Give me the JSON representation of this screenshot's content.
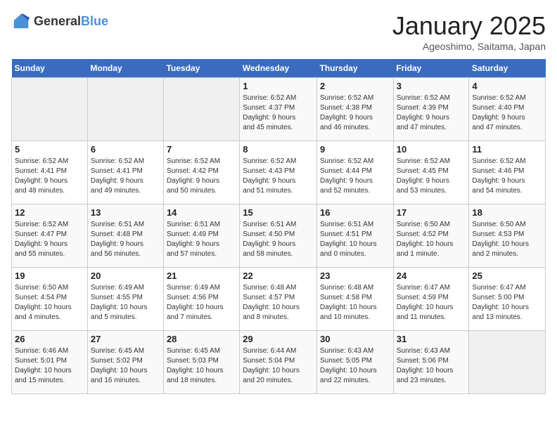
{
  "header": {
    "logo_general": "General",
    "logo_blue": "Blue",
    "title": "January 2025",
    "subtitle": "Ageoshimo, Saitama, Japan"
  },
  "weekdays": [
    "Sunday",
    "Monday",
    "Tuesday",
    "Wednesday",
    "Thursday",
    "Friday",
    "Saturday"
  ],
  "weeks": [
    [
      {
        "day": "",
        "info": ""
      },
      {
        "day": "",
        "info": ""
      },
      {
        "day": "",
        "info": ""
      },
      {
        "day": "1",
        "info": "Sunrise: 6:52 AM\nSunset: 4:37 PM\nDaylight: 9 hours\nand 45 minutes."
      },
      {
        "day": "2",
        "info": "Sunrise: 6:52 AM\nSunset: 4:38 PM\nDaylight: 9 hours\nand 46 minutes."
      },
      {
        "day": "3",
        "info": "Sunrise: 6:52 AM\nSunset: 4:39 PM\nDaylight: 9 hours\nand 47 minutes."
      },
      {
        "day": "4",
        "info": "Sunrise: 6:52 AM\nSunset: 4:40 PM\nDaylight: 9 hours\nand 47 minutes."
      }
    ],
    [
      {
        "day": "5",
        "info": "Sunrise: 6:52 AM\nSunset: 4:41 PM\nDaylight: 9 hours\nand 48 minutes."
      },
      {
        "day": "6",
        "info": "Sunrise: 6:52 AM\nSunset: 4:41 PM\nDaylight: 9 hours\nand 49 minutes."
      },
      {
        "day": "7",
        "info": "Sunrise: 6:52 AM\nSunset: 4:42 PM\nDaylight: 9 hours\nand 50 minutes."
      },
      {
        "day": "8",
        "info": "Sunrise: 6:52 AM\nSunset: 4:43 PM\nDaylight: 9 hours\nand 51 minutes."
      },
      {
        "day": "9",
        "info": "Sunrise: 6:52 AM\nSunset: 4:44 PM\nDaylight: 9 hours\nand 52 minutes."
      },
      {
        "day": "10",
        "info": "Sunrise: 6:52 AM\nSunset: 4:45 PM\nDaylight: 9 hours\nand 53 minutes."
      },
      {
        "day": "11",
        "info": "Sunrise: 6:52 AM\nSunset: 4:46 PM\nDaylight: 9 hours\nand 54 minutes."
      }
    ],
    [
      {
        "day": "12",
        "info": "Sunrise: 6:52 AM\nSunset: 4:47 PM\nDaylight: 9 hours\nand 55 minutes."
      },
      {
        "day": "13",
        "info": "Sunrise: 6:51 AM\nSunset: 4:48 PM\nDaylight: 9 hours\nand 56 minutes."
      },
      {
        "day": "14",
        "info": "Sunrise: 6:51 AM\nSunset: 4:49 PM\nDaylight: 9 hours\nand 57 minutes."
      },
      {
        "day": "15",
        "info": "Sunrise: 6:51 AM\nSunset: 4:50 PM\nDaylight: 9 hours\nand 58 minutes."
      },
      {
        "day": "16",
        "info": "Sunrise: 6:51 AM\nSunset: 4:51 PM\nDaylight: 10 hours\nand 0 minutes."
      },
      {
        "day": "17",
        "info": "Sunrise: 6:50 AM\nSunset: 4:52 PM\nDaylight: 10 hours\nand 1 minute."
      },
      {
        "day": "18",
        "info": "Sunrise: 6:50 AM\nSunset: 4:53 PM\nDaylight: 10 hours\nand 2 minutes."
      }
    ],
    [
      {
        "day": "19",
        "info": "Sunrise: 6:50 AM\nSunset: 4:54 PM\nDaylight: 10 hours\nand 4 minutes."
      },
      {
        "day": "20",
        "info": "Sunrise: 6:49 AM\nSunset: 4:55 PM\nDaylight: 10 hours\nand 5 minutes."
      },
      {
        "day": "21",
        "info": "Sunrise: 6:49 AM\nSunset: 4:56 PM\nDaylight: 10 hours\nand 7 minutes."
      },
      {
        "day": "22",
        "info": "Sunrise: 6:48 AM\nSunset: 4:57 PM\nDaylight: 10 hours\nand 8 minutes."
      },
      {
        "day": "23",
        "info": "Sunrise: 6:48 AM\nSunset: 4:58 PM\nDaylight: 10 hours\nand 10 minutes."
      },
      {
        "day": "24",
        "info": "Sunrise: 6:47 AM\nSunset: 4:59 PM\nDaylight: 10 hours\nand 11 minutes."
      },
      {
        "day": "25",
        "info": "Sunrise: 6:47 AM\nSunset: 5:00 PM\nDaylight: 10 hours\nand 13 minutes."
      }
    ],
    [
      {
        "day": "26",
        "info": "Sunrise: 6:46 AM\nSunset: 5:01 PM\nDaylight: 10 hours\nand 15 minutes."
      },
      {
        "day": "27",
        "info": "Sunrise: 6:45 AM\nSunset: 5:02 PM\nDaylight: 10 hours\nand 16 minutes."
      },
      {
        "day": "28",
        "info": "Sunrise: 6:45 AM\nSunset: 5:03 PM\nDaylight: 10 hours\nand 18 minutes."
      },
      {
        "day": "29",
        "info": "Sunrise: 6:44 AM\nSunset: 5:04 PM\nDaylight: 10 hours\nand 20 minutes."
      },
      {
        "day": "30",
        "info": "Sunrise: 6:43 AM\nSunset: 5:05 PM\nDaylight: 10 hours\nand 22 minutes."
      },
      {
        "day": "31",
        "info": "Sunrise: 6:43 AM\nSunset: 5:06 PM\nDaylight: 10 hours\nand 23 minutes."
      },
      {
        "day": "",
        "info": ""
      }
    ]
  ]
}
